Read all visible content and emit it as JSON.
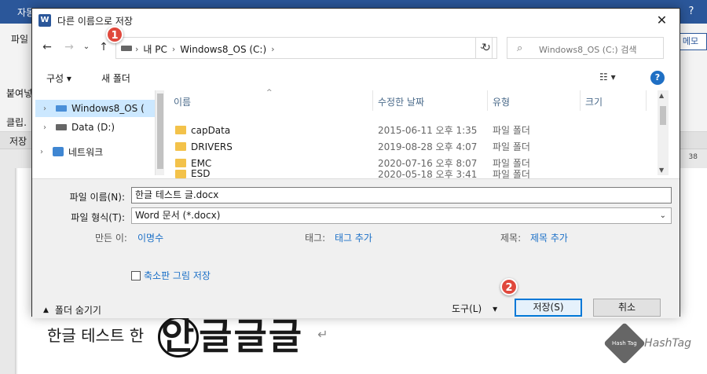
{
  "background": {
    "title_fragment": "자동",
    "help": "?",
    "ribbon": {
      "file": "파일",
      "paste": "붙여넣",
      "clipboard": "클립.",
      "memo_btn": "메모"
    },
    "tabbar": {
      "label": "저장"
    },
    "ruler_number": "38",
    "document": {
      "text_small": "한글 테스트 한",
      "text_large": "안글글글",
      "pilcrow": "↵"
    },
    "watermark": {
      "text": "HashTag",
      "cube_text": "Hash Tag"
    }
  },
  "dialog": {
    "title": "다른 이름으로 저장",
    "close": "✕",
    "nav": {
      "back": "←",
      "forward": "→",
      "recent": "⌄",
      "up": "↑",
      "refresh": "↻"
    },
    "address": {
      "items": [
        "내 PC",
        "Windows8_OS (C:)"
      ],
      "sep": "›",
      "dropdown": "⌄"
    },
    "search": {
      "placeholder": "Windows8_OS (C:) 검색",
      "icon": "⌕"
    },
    "commands": {
      "organize": "구성 ▾",
      "new_folder": "새 폴더",
      "view": "☷ ▾",
      "help": "?"
    },
    "nav_pane": {
      "items": [
        {
          "label": "Windows8_OS (",
          "selected": true
        },
        {
          "label": "Data (D:)",
          "selected": false
        },
        {
          "label": "네트워크",
          "selected": false
        }
      ],
      "chev": "›"
    },
    "files": {
      "columns": [
        "이름",
        "수정한 날짜",
        "유형",
        "크기"
      ],
      "sort_icon": "^",
      "rows": [
        {
          "name": "capData",
          "date": "2015-06-11 오후 1:35",
          "type": "파일 폴더"
        },
        {
          "name": "DRIVERS",
          "date": "2019-08-28 오후 4:07",
          "type": "파일 폴더"
        },
        {
          "name": "EMC",
          "date": "2020-07-16 오후 8:07",
          "type": "파일 폴더"
        },
        {
          "name": "ESD",
          "date": "2020-05-18 오후 3:41",
          "type": "파일 폴더"
        }
      ],
      "scroll_up": "▲",
      "scroll_down": "▼"
    },
    "form": {
      "filename_label": "파일 이름(N):",
      "filename_value": "한글 테스트  글.docx",
      "filetype_label": "파일 형식(T):",
      "filetype_value": "Word 문서 (*.docx)",
      "author_label": "만든 이:",
      "author_value": "이명수",
      "tags_label": "태그:",
      "tags_value": "태그 추가",
      "title_label": "제목:",
      "title_value": "제목 추가",
      "thumbnail_label": "축소판 그림 저장",
      "hide_folders": "폴더 숨기기",
      "hide_icon": "▲",
      "tools": "도구(L)",
      "tools_drop": "▾",
      "save": "저장(S)",
      "cancel": "취소"
    },
    "badges": {
      "one": "1",
      "two": "2"
    },
    "colors": {
      "accent": "#0078d7",
      "badge": "#e0483c",
      "link": "#1a6fc7",
      "word_blue": "#2b579a"
    }
  }
}
